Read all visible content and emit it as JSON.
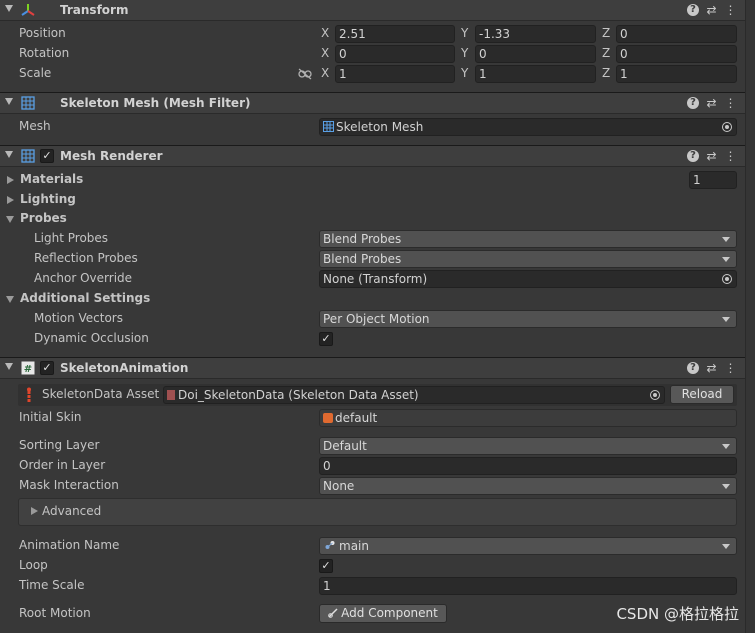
{
  "transform": {
    "title": "Transform",
    "position_label": "Position",
    "rotation_label": "Rotation",
    "scale_label": "Scale",
    "axis_x": "X",
    "axis_y": "Y",
    "axis_z": "Z",
    "position": {
      "x": "2.51",
      "y": "-1.33",
      "z": "0"
    },
    "rotation": {
      "x": "0",
      "y": "0",
      "z": "0"
    },
    "scale": {
      "x": "1",
      "y": "1",
      "z": "1"
    }
  },
  "mesh_filter": {
    "title": "Skeleton Mesh (Mesh Filter)",
    "mesh_label": "Mesh",
    "mesh_value": "Skeleton Mesh"
  },
  "mesh_renderer": {
    "title": "Mesh Renderer",
    "enabled_mark": "✓",
    "materials_label": "Materials",
    "materials_count": "1",
    "lighting_label": "Lighting",
    "probes_label": "Probes",
    "light_probes_label": "Light Probes",
    "light_probes_value": "Blend Probes",
    "reflection_probes_label": "Reflection Probes",
    "reflection_probes_value": "Blend Probes",
    "anchor_override_label": "Anchor Override",
    "anchor_override_value": "None (Transform)",
    "additional_settings_label": "Additional Settings",
    "motion_vectors_label": "Motion Vectors",
    "motion_vectors_value": "Per Object Motion",
    "dynamic_occlusion_label": "Dynamic Occlusion",
    "dynamic_occlusion_mark": "✓"
  },
  "skeleton_animation": {
    "title": "SkeletonAnimation",
    "enabled_mark": "✓",
    "skeleton_data_label": "SkeletonData Asset",
    "skeleton_data_value": "Doi_SkeletonData (Skeleton Data Asset)",
    "reload_label": "Reload",
    "initial_skin_label": "Initial Skin",
    "initial_skin_value": "default",
    "sorting_layer_label": "Sorting Layer",
    "sorting_layer_value": "Default",
    "order_in_layer_label": "Order in Layer",
    "order_in_layer_value": "0",
    "mask_interaction_label": "Mask Interaction",
    "mask_interaction_value": "None",
    "advanced_label": "Advanced",
    "animation_name_label": "Animation Name",
    "animation_name_value": "main",
    "loop_label": "Loop",
    "loop_mark": "✓",
    "time_scale_label": "Time Scale",
    "time_scale_value": "1",
    "root_motion_label": "Root Motion",
    "add_component_label": "Add Component"
  },
  "header_buttons": {
    "help": "?",
    "presets": "⇄",
    "menu": "⋮"
  },
  "watermark": "CSDN @格拉格拉",
  "colors": {
    "background": "#383838",
    "header": "#3e3e3e",
    "field": "#2a2a2a",
    "dropdown": "#515151"
  }
}
